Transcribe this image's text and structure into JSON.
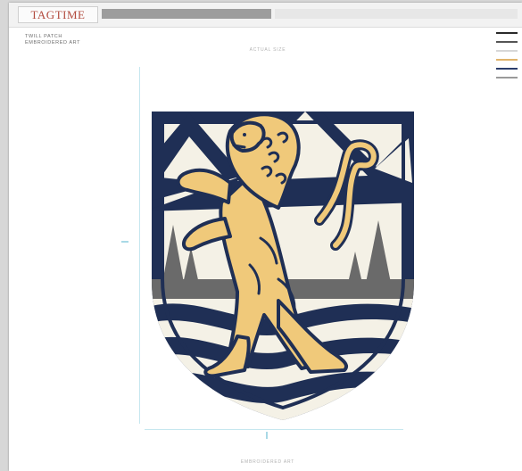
{
  "header": {
    "logo_text": "TAGTIME",
    "nav_dark": [
      "",
      "",
      "",
      ""
    ],
    "nav_light": [
      "",
      "",
      "",
      "",
      ""
    ]
  },
  "page": {
    "title_line1": "TWILL PATCH",
    "title_line2": "EMBROIDERED ART",
    "top_caption": "ACTUAL SIZE",
    "bottom_caption": "EMBROIDERED ART"
  },
  "palette": [
    "#2a2a2a",
    "#555555",
    "#d7d7d7",
    "#e0b46c",
    "#2b3d6b",
    "#9a9a9a"
  ],
  "crest": {
    "navy": "#1f2f55",
    "gold": "#f0c97a",
    "cream": "#f4f1e6",
    "gray": "#6a6a6a"
  }
}
